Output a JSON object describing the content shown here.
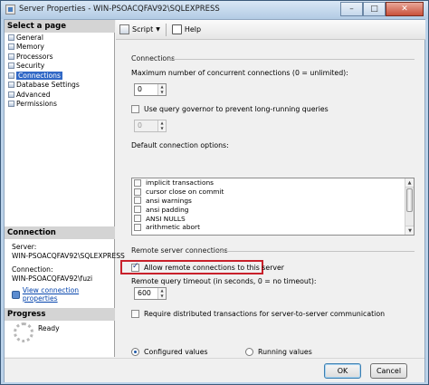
{
  "window": {
    "title": "Server Properties - WIN-PSOACQFAV92\\SQLEXPRESS",
    "minimize": "–",
    "maximize": "□",
    "close": "✕"
  },
  "left_pane": {
    "select_header": "Select a page",
    "pages": [
      {
        "label": "General"
      },
      {
        "label": "Memory"
      },
      {
        "label": "Processors"
      },
      {
        "label": "Security"
      },
      {
        "label": "Connections",
        "selected": true
      },
      {
        "label": "Database Settings"
      },
      {
        "label": "Advanced"
      },
      {
        "label": "Permissions"
      }
    ],
    "connection_header": "Connection",
    "server_label": "Server:",
    "server_value": "WIN-PSOACQFAV92\\SQLEXPRESS",
    "connection_label": "Connection:",
    "connection_value": "WIN-PSOACQFAV92\\fuzi",
    "view_link": "View connection properties",
    "progress_header": "Progress",
    "progress_status": "Ready"
  },
  "toolbar": {
    "script_label": "Script",
    "help_label": "Help"
  },
  "connections": {
    "section_title": "Connections",
    "max_label": "Maximum number of concurrent connections (0 = unlimited):",
    "max_value": "0",
    "governor_label": "Use query governor to prevent long-running queries",
    "governor_checked": false,
    "governor_value": "0",
    "default_options_label": "Default connection options:",
    "default_options": [
      {
        "label": "implicit transactions",
        "checked": false
      },
      {
        "label": "cursor close on commit",
        "checked": false
      },
      {
        "label": "ansi warnings",
        "checked": false
      },
      {
        "label": "ansi padding",
        "checked": false
      },
      {
        "label": "ANSI NULLS",
        "checked": false
      },
      {
        "label": "arithmetic abort",
        "checked": false
      }
    ]
  },
  "remote": {
    "section_title": "Remote server connections",
    "allow_label": "Allow remote connections to this server",
    "allow_checked": true,
    "timeout_label": "Remote query timeout (in seconds, 0 = no timeout):",
    "timeout_value": "600",
    "distributed_label": "Require distributed transactions for server-to-server communication",
    "distributed_checked": false
  },
  "values_mode": {
    "configured_label": "Configured values",
    "running_label": "Running values",
    "selected": "configured"
  },
  "buttons": {
    "ok": "OK",
    "cancel": "Cancel"
  },
  "colors": {
    "selection": "#3168c6",
    "highlight_box": "#c8202a",
    "link": "#0645ad"
  }
}
